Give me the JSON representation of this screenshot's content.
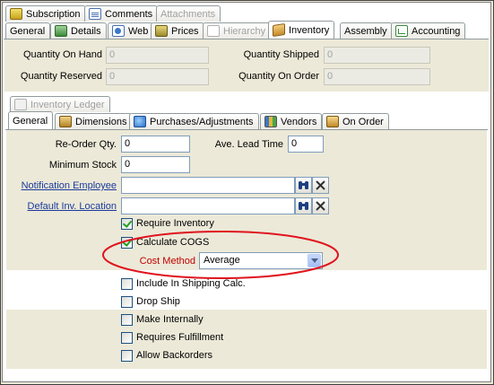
{
  "top_tabs_row1": [
    {
      "label": "Subscription",
      "icon": "subscription-icon",
      "state": "normal"
    },
    {
      "label": "Comments",
      "icon": "comments-icon",
      "state": "normal"
    },
    {
      "label": "Attachments",
      "icon": "",
      "state": "disabled"
    }
  ],
  "top_tabs_row2": [
    {
      "label": "General",
      "icon": "",
      "state": "normal"
    },
    {
      "label": "Details",
      "icon": "details-icon",
      "state": "normal"
    },
    {
      "label": "Web",
      "icon": "web-icon",
      "state": "normal"
    },
    {
      "label": "Prices",
      "icon": "prices-icon",
      "state": "normal"
    },
    {
      "label": "Hierarchy",
      "icon": "hierarchy-icon",
      "state": "disabled"
    },
    {
      "label": "Inventory",
      "icon": "inventory-icon",
      "state": "active"
    },
    {
      "label": "Assembly",
      "icon": "",
      "state": "normal"
    },
    {
      "label": "Accounting",
      "icon": "accounting-icon",
      "state": "normal"
    }
  ],
  "quantities": {
    "on_hand_label": "Quantity On Hand",
    "on_hand_value": "0",
    "reserved_label": "Quantity Reserved",
    "reserved_value": "0",
    "shipped_label": "Quantity Shipped",
    "shipped_value": "0",
    "on_order_label": "Quantity On Order",
    "on_order_value": "0"
  },
  "sub_tabs_row1": [
    {
      "label": "Inventory Ledger",
      "icon": "ledger-icon",
      "state": "disabled"
    }
  ],
  "sub_tabs_row2": [
    {
      "label": "General",
      "icon": "",
      "state": "active"
    },
    {
      "label": "Dimensions",
      "icon": "dimensions-icon",
      "state": "normal"
    },
    {
      "label": "Purchases/Adjustments",
      "icon": "purchases-icon",
      "state": "normal"
    },
    {
      "label": "Vendors",
      "icon": "vendors-icon",
      "state": "normal"
    },
    {
      "label": "On Order",
      "icon": "on-order-icon",
      "state": "normal"
    }
  ],
  "general": {
    "reorder_label": "Re-Order Qty.",
    "reorder_value": "0",
    "lead_time_label": "Ave. Lead Time",
    "lead_time_value": "0",
    "min_stock_label": "Minimum Stock",
    "min_stock_value": "0",
    "notification_label": "Notification Employee",
    "notification_value": "",
    "location_label": "Default Inv. Location",
    "location_value": "",
    "cost_method_label": "Cost Method",
    "cost_method_value": "Average"
  },
  "checkboxes": [
    {
      "label": "Require Inventory",
      "checked": true
    },
    {
      "label": "Calculate COGS",
      "checked": true
    },
    {
      "label": "Include In Shipping Calc.",
      "checked": false
    },
    {
      "label": "Drop Ship",
      "checked": false
    },
    {
      "label": "Make Internally",
      "checked": false
    },
    {
      "label": "Requires Fulfillment",
      "checked": false
    },
    {
      "label": "Allow Backorders",
      "checked": false
    }
  ],
  "colors": {
    "highlight_ellipse": "#e0141e",
    "link": "#1a3a9c",
    "cost_method_label": "#c00000"
  },
  "icons": {
    "binoculars": "binoculars-icon",
    "clear": "clear-x-icon",
    "dropdown": "chevron-down-icon"
  }
}
